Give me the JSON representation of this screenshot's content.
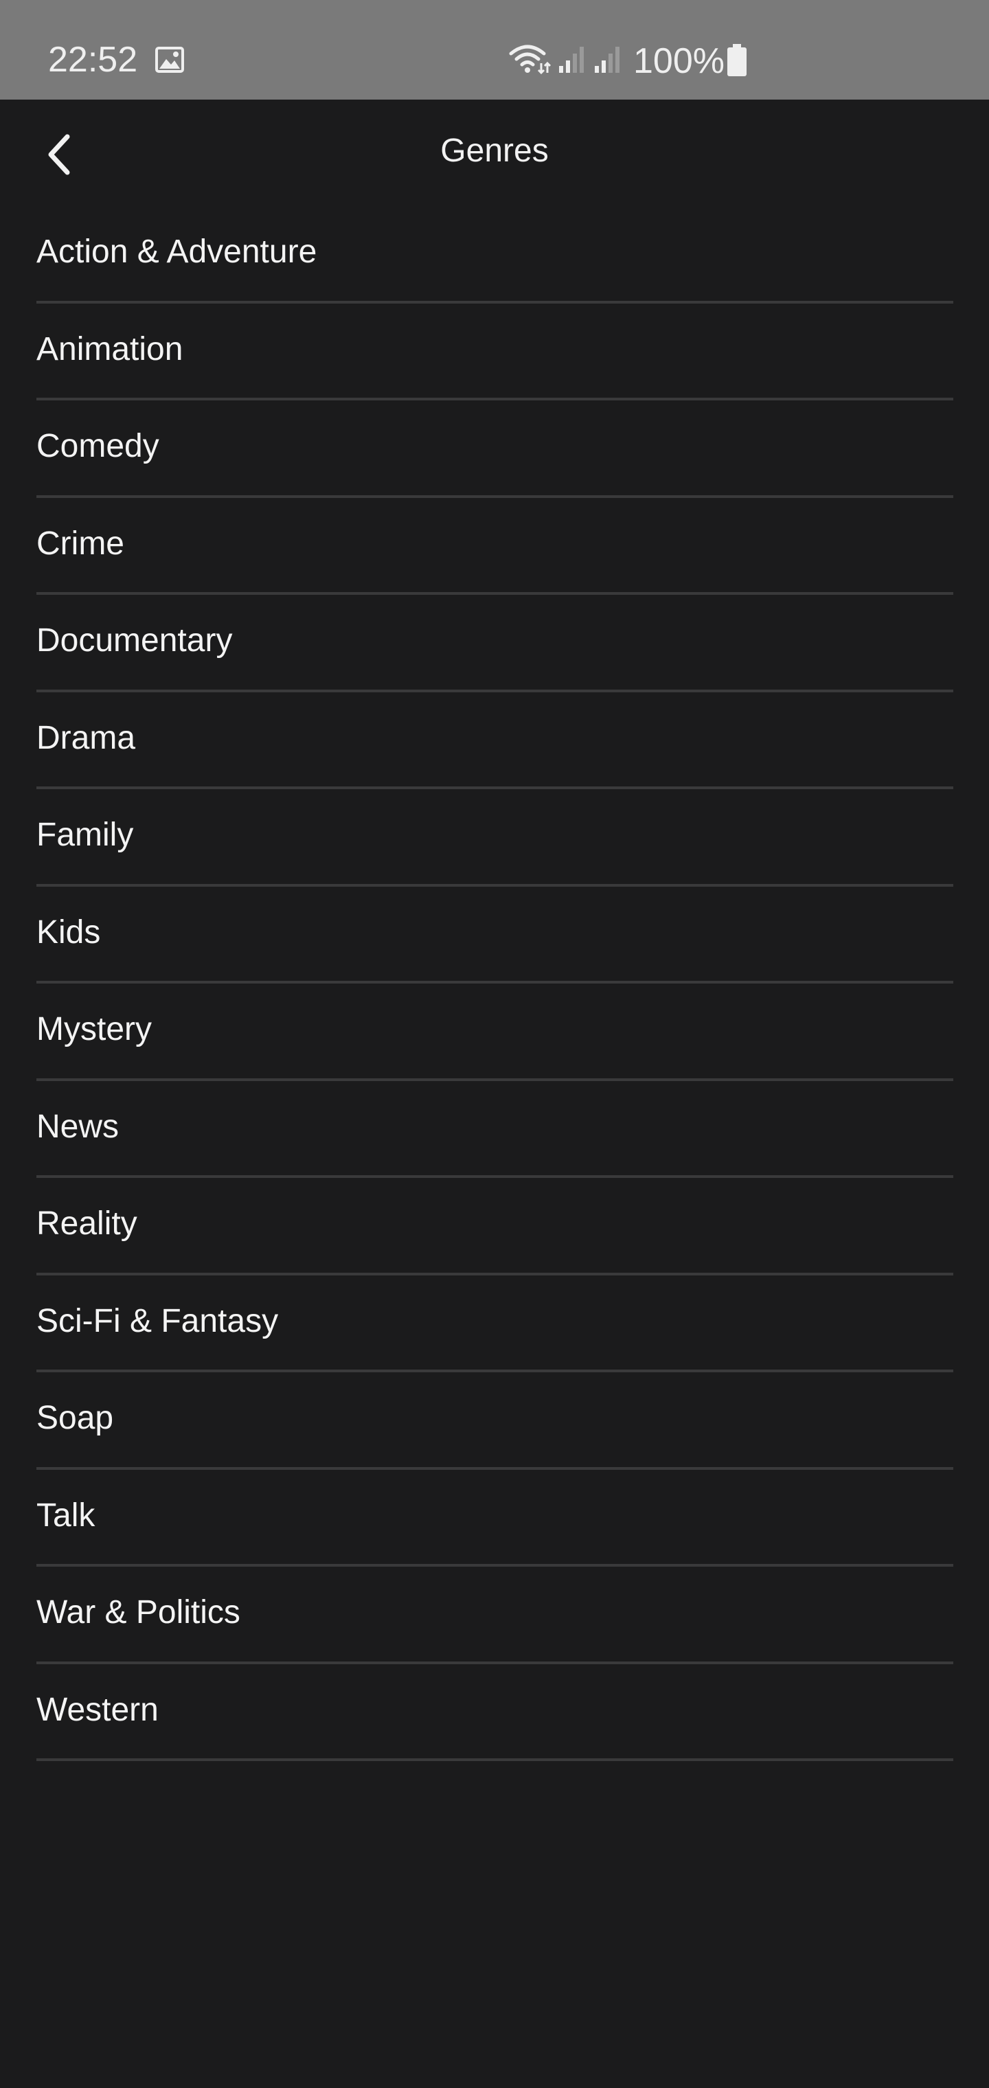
{
  "status_bar": {
    "time": "22:52",
    "battery": "100%",
    "icons": [
      "gallery-icon",
      "wifi-icon",
      "signal-icon",
      "signal-icon",
      "battery-icon"
    ]
  },
  "header": {
    "title": "Genres",
    "back_icon": "chevron-left-icon"
  },
  "genres": [
    {
      "label": "Action & Adventure"
    },
    {
      "label": "Animation"
    },
    {
      "label": "Comedy"
    },
    {
      "label": "Crime"
    },
    {
      "label": "Documentary"
    },
    {
      "label": "Drama"
    },
    {
      "label": "Family"
    },
    {
      "label": "Kids"
    },
    {
      "label": "Mystery"
    },
    {
      "label": "News"
    },
    {
      "label": "Reality"
    },
    {
      "label": "Sci-Fi & Fantasy"
    },
    {
      "label": "Soap"
    },
    {
      "label": "Talk"
    },
    {
      "label": "War & Politics"
    },
    {
      "label": "Western"
    }
  ],
  "colors": {
    "background": "#1b1b1c",
    "status_bar": "#7a7a7a",
    "divider": "#3a3a3b",
    "text": "#f4f4f4"
  }
}
